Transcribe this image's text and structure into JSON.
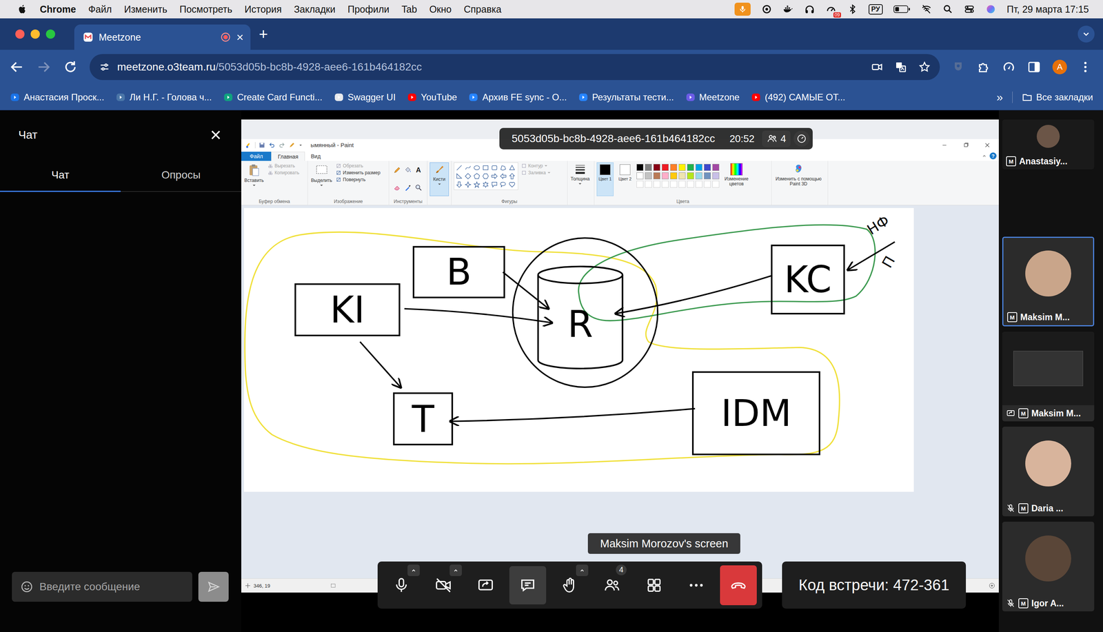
{
  "menubar": {
    "app": "Chrome",
    "items": [
      "Файл",
      "Изменить",
      "Посмотреть",
      "История",
      "Закладки",
      "Профили",
      "Tab",
      "Окно",
      "Справка"
    ],
    "mic_active": true,
    "badge": "09",
    "input_source": "РУ",
    "datetime": "Пт, 29 марта 17:15"
  },
  "browser": {
    "tabs": [
      {
        "title": "Meetzone",
        "selected": true,
        "recording": true,
        "close": "×"
      }
    ],
    "new_tab": "+",
    "url": {
      "host": "meetzone.o3team.ru",
      "path": "/5053d05b-bc8b-4928-aee6-161b464182cc"
    },
    "back_enabled": true,
    "forward_enabled": false,
    "profile": "A",
    "bookmarks": [
      {
        "label": "Анастасия Проск...",
        "color": "#1a73e8"
      },
      {
        "label": "Ли Н.Г. - Голова ч...",
        "color": "#4a76a8"
      },
      {
        "label": "Create Card Functi...",
        "color": "#10a37f"
      },
      {
        "label": "Swagger UI",
        "color": "#e8eaed"
      },
      {
        "label": "YouTube",
        "color": "#ff0000"
      },
      {
        "label": "Архив FE sync - О...",
        "color": "#2684ff"
      },
      {
        "label": "Результаты тести...",
        "color": "#2684ff"
      },
      {
        "label": "Meetzone",
        "color": "#6c5ce7"
      },
      {
        "label": "(492) САМЫЕ ОТ...",
        "color": "#ff0000"
      }
    ],
    "more_bookmarks": "»",
    "all_bookmarks": "Все закладки"
  },
  "chat": {
    "title": "Чат",
    "close": "×",
    "tabs": [
      {
        "label": "Чат",
        "selected": true
      },
      {
        "label": "Опросы",
        "selected": false
      }
    ],
    "input": {
      "placeholder": "Введите сообщение"
    }
  },
  "meeting": {
    "room": "5053d05b-bc8b-4928-aee6-161b464182cc",
    "elapsed": "20:52",
    "participants_count": "4",
    "presenter": "Maksim Morozov's screen",
    "controls": [
      {
        "kind": "mic",
        "menu": true,
        "active": false,
        "off": false,
        "badge": ""
      },
      {
        "kind": "camera",
        "menu": true,
        "active": false,
        "off": true,
        "badge": ""
      },
      {
        "kind": "share",
        "menu": false,
        "active": false,
        "off": false,
        "badge": ""
      },
      {
        "kind": "chat",
        "menu": false,
        "active": true,
        "off": false,
        "badge": ""
      },
      {
        "kind": "hand",
        "menu": true,
        "active": false,
        "off": false,
        "badge": ""
      },
      {
        "kind": "people",
        "menu": false,
        "active": false,
        "off": false,
        "badge": "4"
      },
      {
        "kind": "layout",
        "menu": false,
        "active": false,
        "off": false,
        "badge": ""
      },
      {
        "kind": "more",
        "menu": false,
        "active": false,
        "off": false,
        "badge": ""
      },
      {
        "kind": "leave",
        "menu": false,
        "active": false,
        "off": false,
        "badge": ""
      }
    ],
    "code": "Код встречи: 472-361"
  },
  "paint": {
    "title": "ымянный - Paint",
    "tabs": [
      {
        "label": "Файл",
        "selected": false,
        "kind": "file"
      },
      {
        "label": "Главная",
        "selected": true,
        "kind": "tab"
      },
      {
        "label": "Вид",
        "selected": false,
        "kind": "tab"
      }
    ],
    "help": "?",
    "clipboard": {
      "label": "Буфер обмена",
      "paste": "Вставить",
      "items": [
        {
          "label": "Вырезать",
          "disabled": true
        },
        {
          "label": "Копировать",
          "disabled": true
        }
      ]
    },
    "image": {
      "label": "Изображение",
      "select": "Выделить",
      "items": [
        {
          "label": "Обрезать",
          "disabled": true
        },
        {
          "label": "Изменить размер",
          "disabled": false
        },
        {
          "label": "Повернуть",
          "disabled": false
        }
      ]
    },
    "tools": {
      "label": "Инструменты",
      "text_tool": "A"
    },
    "brushes": {
      "label": "Кисти",
      "selected": true
    },
    "shapes": {
      "label": "Фигуры",
      "items": [
        {
          "label": "Контур",
          "disabled": true
        },
        {
          "label": "Заливка",
          "disabled": true
        }
      ]
    },
    "size": {
      "label": "Толщина"
    },
    "colors": {
      "label": "Цвета",
      "slots": [
        {
          "label": "Цвет 1",
          "value": "#000000",
          "selected": true
        },
        {
          "label": "Цвет 2",
          "value": "#ffffff",
          "selected": false
        }
      ],
      "palette": [
        {
          "color": "#000000"
        },
        {
          "color": "#7f7f7f"
        },
        {
          "color": "#880015"
        },
        {
          "color": "#ed1c24"
        },
        {
          "color": "#ff7f27"
        },
        {
          "color": "#fff200"
        },
        {
          "color": "#22b14c"
        },
        {
          "color": "#00a2e8"
        },
        {
          "color": "#3f48cc"
        },
        {
          "color": "#a349a4"
        },
        {
          "color": "#ffffff"
        },
        {
          "color": "#c3c3c3"
        },
        {
          "color": "#b97a57"
        },
        {
          "color": "#ffaec9"
        },
        {
          "color": "#ffc90e"
        },
        {
          "color": "#efe4b0"
        },
        {
          "color": "#b5e61d"
        },
        {
          "color": "#99d9ea"
        },
        {
          "color": "#7092be"
        },
        {
          "color": "#c8bfe7"
        }
      ],
      "edit": "Изменение цветов"
    },
    "paint3d": {
      "label": "Изменить с помощью Paint 3D"
    },
    "canvas": {
      "nodes": [
        {
          "label": "KI",
          "shape": "box",
          "circled": false
        },
        {
          "label": "B",
          "shape": "box",
          "circled": false
        },
        {
          "label": "R",
          "shape": "cylinder",
          "circled": true
        },
        {
          "label": "KC",
          "shape": "box",
          "circled": false
        },
        {
          "label": "T",
          "shape": "box",
          "circled": false
        },
        {
          "label": "IDM",
          "shape": "box",
          "circled": false
        }
      ],
      "edges": [
        {
          "from": "KI",
          "to": "R"
        },
        {
          "from": "B",
          "to": "R"
        },
        {
          "from": "KC",
          "to": "R"
        },
        {
          "from": "KI",
          "to": "T"
        },
        {
          "from": "IDM",
          "to": "T"
        }
      ],
      "outlines": [
        {
          "color": "#f0e03a"
        },
        {
          "color": "#3c9a50"
        }
      ],
      "notes": [
        {
          "text": "НФ"
        },
        {
          "text": "П"
        }
      ]
    },
    "status": {
      "position": "346, 19"
    }
  },
  "participants": [
    {
      "name": "Anastasiy...",
      "badge": "M",
      "muted": false,
      "selected": false,
      "kind": "camera"
    },
    {
      "name": "Maksim M...",
      "badge": "M",
      "muted": false,
      "selected": true,
      "kind": "camera"
    },
    {
      "name": "Maksim M...",
      "badge": "M",
      "muted": false,
      "selected": false,
      "kind": "screen"
    },
    {
      "name": "Daria ...",
      "badge": "M",
      "muted": true,
      "selected": false,
      "kind": "camera"
    },
    {
      "name": "Igor A...",
      "badge": "M",
      "muted": true,
      "selected": false,
      "kind": "camera"
    }
  ]
}
